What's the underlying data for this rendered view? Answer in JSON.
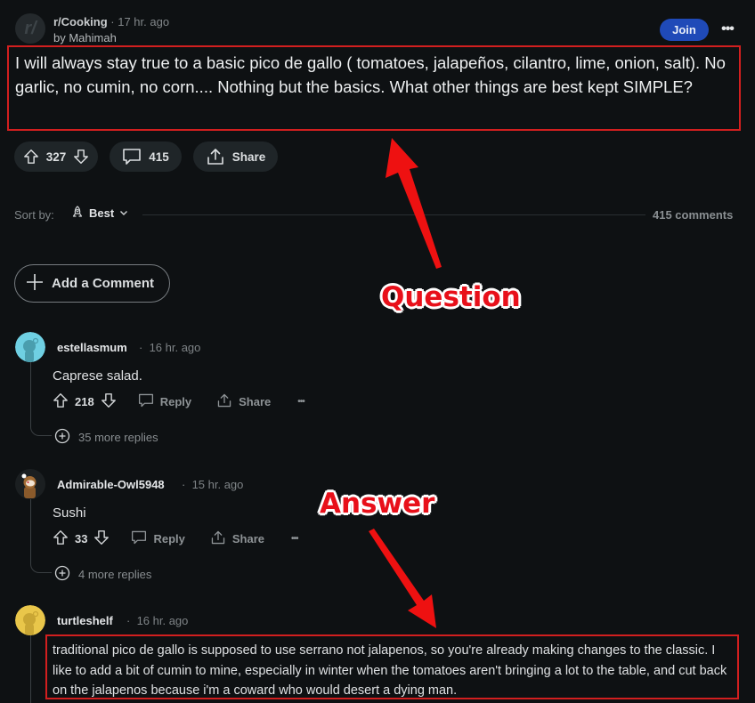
{
  "post": {
    "subreddit": "r/Cooking",
    "time_meta": "· 17 hr. ago",
    "author_line": "by Mahimah",
    "avatar_glyph": "r/",
    "join_label": "Join",
    "more_label": "•••",
    "title": "I will always stay true to a basic pico de gallo ( tomatoes, jalapeños, cilantro, lime, onion, salt). No garlic, no cumin, no corn.... Nothing but the basics. What other things are best kept SIMPLE?",
    "upvotes": "327",
    "comment_count": "415",
    "share_label": "Share"
  },
  "sort": {
    "label": "Sort by:",
    "selected": "Best",
    "total_comments": "415 comments"
  },
  "add_comment_label": "Add a Comment",
  "comments": [
    {
      "user": "estellasmum",
      "time": "16 hr. ago",
      "body": "Caprese salad.",
      "score": "218",
      "reply_label": "Reply",
      "share_label": "Share",
      "more_label": "•••",
      "more_replies": "35 more replies",
      "avatar_color": "#6fd0e3"
    },
    {
      "user": "Admirable-Owl5948",
      "time": "15 hr. ago",
      "body": "Sushi",
      "score": "33",
      "reply_label": "Reply",
      "share_label": "Share",
      "more_label": "•••",
      "more_replies": "4 more replies",
      "avatar_color": "#8a5a2b"
    },
    {
      "user": "turtleshelf",
      "time": "16 hr. ago",
      "body": "traditional pico de gallo is supposed to use serrano not jalapenos, so you're already making changes to the classic. I like to add a bit of cumin to mine, especially in winter when the tomatoes aren't bringing a lot to the table, and cut back on the jalapenos because i'm a coward who would desert a dying man.",
      "avatar_color": "#e9c64a"
    }
  ],
  "annotations": {
    "question": "Question",
    "answer": "Answer",
    "color": "#e8101a"
  },
  "colors": {
    "background": "#0e1113",
    "join_button": "#1f4ab8",
    "highlight_box": "#d21f1f"
  }
}
